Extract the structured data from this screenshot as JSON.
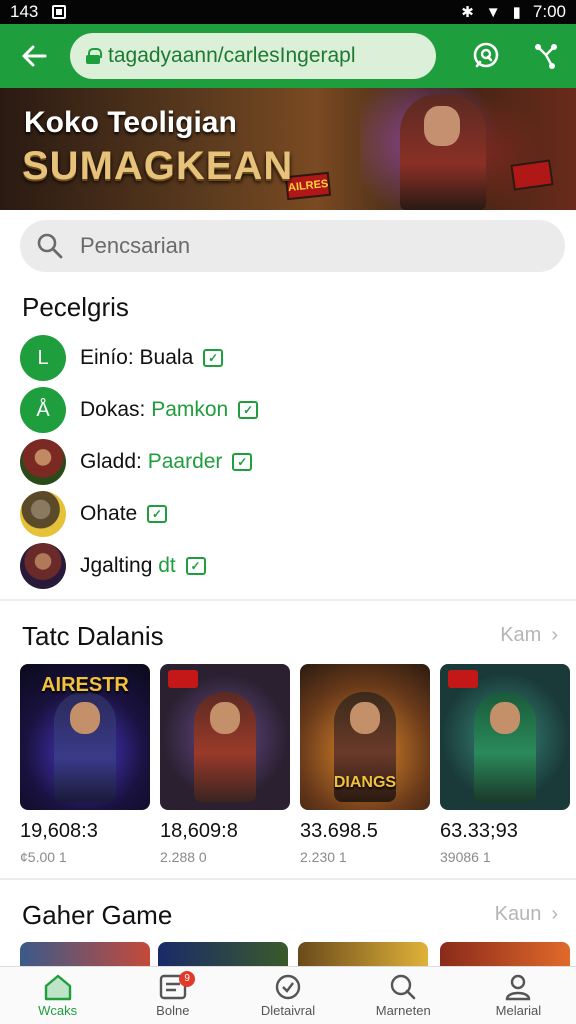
{
  "status_bar": {
    "left_text": "143",
    "time": "7:00"
  },
  "browser": {
    "url": "tagadyaann/carlesIngerapl",
    "back_icon": "arrow-left-icon",
    "actions": [
      "search-icon",
      "share-icon"
    ]
  },
  "banner": {
    "subtitle": "Koko Teoligian",
    "title": "SUMAGKEAN",
    "badge_top": "AILRES"
  },
  "search": {
    "placeholder": "Pencsarian"
  },
  "people": {
    "title": "Pecelgris",
    "items": [
      {
        "initial": "L",
        "name": "Einío: Buala",
        "name_plain": "Einío: Buala",
        "highlight": ""
      },
      {
        "initial": "Å",
        "name": "Dokas: ",
        "highlight": "Pamkon"
      },
      {
        "initial": "",
        "name": "Gladd: ",
        "highlight": "Paarder"
      },
      {
        "initial": "",
        "name": "Ohate",
        "highlight": ""
      },
      {
        "initial": "",
        "name": "Jgalting ",
        "highlight": "dt"
      }
    ]
  },
  "trending": {
    "title": "Tatc Dalanis",
    "more": "Kam",
    "cards": [
      {
        "caption": "AIRESTR",
        "value": "19,608:3",
        "sub": "¢5.00 1"
      },
      {
        "caption": "",
        "value": "18,609:8",
        "sub": "2.288 0"
      },
      {
        "caption": "DIANGS",
        "value": "33.698.5",
        "sub": "2.230 1"
      },
      {
        "caption": "",
        "value": "63.33;93",
        "sub": "39086 1"
      }
    ]
  },
  "more_games": {
    "title": "Gaher Game",
    "more": "Kaun"
  },
  "bottom_nav": {
    "items": [
      {
        "label": "Wcaks",
        "icon": "home-icon",
        "active": true
      },
      {
        "label": "Bolne",
        "icon": "list-icon",
        "badge": "9"
      },
      {
        "label": "Dletaivral",
        "icon": "check-circle-icon"
      },
      {
        "label": "Marneten",
        "icon": "search-icon"
      },
      {
        "label": "Melarial",
        "icon": "profile-icon"
      }
    ]
  },
  "colors": {
    "accent": "#1f9e3d",
    "url_bar": "#1f9e3d",
    "url_field": "#dcefd9"
  }
}
